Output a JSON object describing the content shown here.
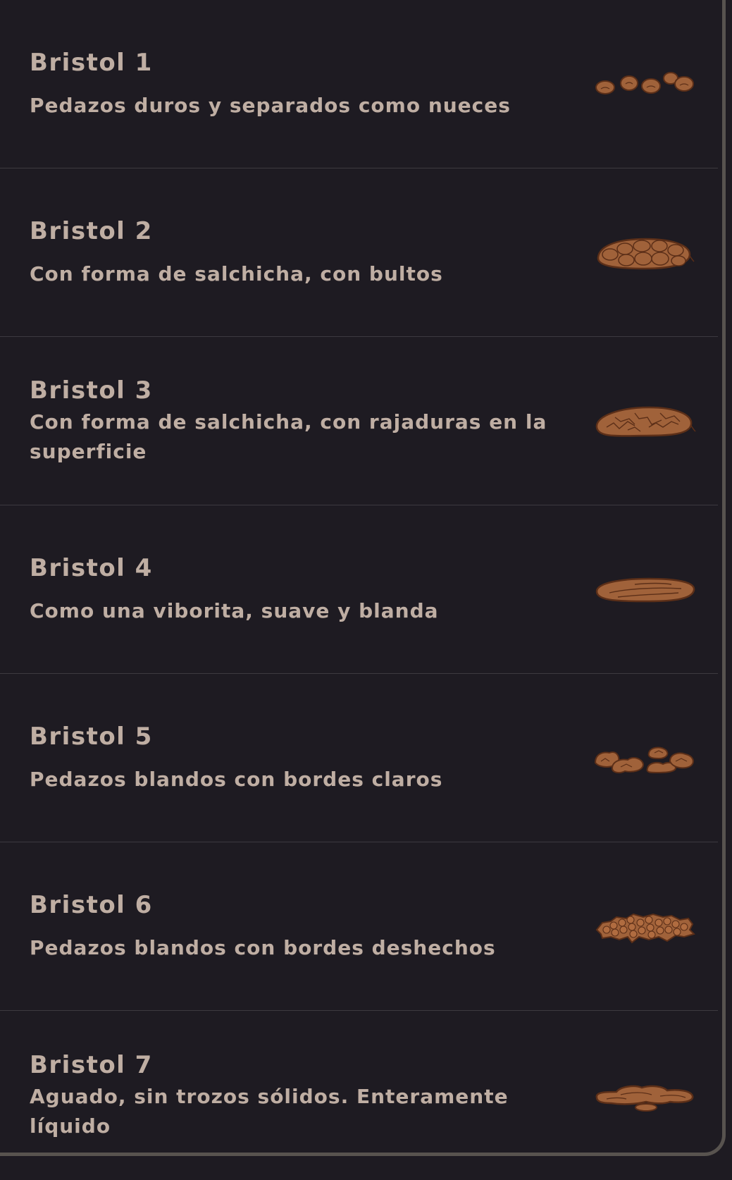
{
  "types": [
    {
      "title": "Bristol 1",
      "description": "Pedazos duros y separados como nueces",
      "icon": "separate-hard-lumps-icon"
    },
    {
      "title": "Bristol 2",
      "description": "Con forma de salchicha, con bultos",
      "icon": "lumpy-sausage-icon"
    },
    {
      "title": "Bristol 3",
      "description": "Con forma de salchicha, con rajaduras en la superficie",
      "icon": "cracked-sausage-icon"
    },
    {
      "title": "Bristol 4",
      "description": "Como una viborita, suave y blanda",
      "icon": "smooth-snake-icon"
    },
    {
      "title": "Bristol 5",
      "description": "Pedazos blandos con bordes claros",
      "icon": "soft-blobs-icon"
    },
    {
      "title": "Bristol 6",
      "description": "Pedazos blandos con bordes deshechos",
      "icon": "mushy-pieces-icon"
    },
    {
      "title": "Bristol 7",
      "description": "Aguado, sin trozos sólidos. Enteramente líquido",
      "icon": "liquid-puddle-icon"
    }
  ],
  "colors": {
    "background": "#1e1b22",
    "text": "#bfaea3",
    "divider": "#3d3a40",
    "illustration_fill": "#a0623a",
    "illustration_stroke": "#5c2f18"
  }
}
